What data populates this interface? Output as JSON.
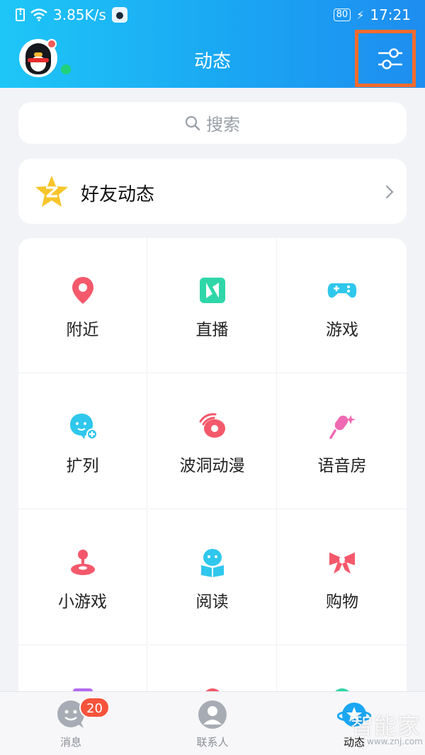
{
  "statusbar": {
    "network_speed": "3.85K/s",
    "battery": "80",
    "time": "17:21"
  },
  "header": {
    "title": "动态"
  },
  "search": {
    "placeholder": "搜索"
  },
  "feed": {
    "title": "好友动态"
  },
  "grid": [
    {
      "label": "附近",
      "icon": "location-pin-icon",
      "color": "#f4596b"
    },
    {
      "label": "直播",
      "icon": "live-icon",
      "color": "#2ed6a8"
    },
    {
      "label": "游戏",
      "icon": "gamepad-icon",
      "color": "#2fc7ec"
    },
    {
      "label": "扩列",
      "icon": "add-friend-icon",
      "color": "#2fc7ec"
    },
    {
      "label": "波洞动漫",
      "icon": "comic-planet-icon",
      "color": "#f4596b"
    },
    {
      "label": "语音房",
      "icon": "microphone-icon",
      "color": "#f06ab3"
    },
    {
      "label": "小游戏",
      "icon": "joystick-icon",
      "color": "#f4596b"
    },
    {
      "label": "阅读",
      "icon": "reading-icon",
      "color": "#2fc7ec"
    },
    {
      "label": "购物",
      "icon": "bow-icon",
      "color": "#f4596b"
    }
  ],
  "tabs": [
    {
      "label": "消息",
      "badge": "20"
    },
    {
      "label": "联系人"
    },
    {
      "label": "动态"
    }
  ],
  "watermark": {
    "text": "智能家",
    "url": "www.znj.com"
  },
  "colors": {
    "header_start": "#1ec6f7",
    "header_end": "#1e8df0",
    "highlight_box": "#f36b2d",
    "badge": "#f5533c"
  }
}
